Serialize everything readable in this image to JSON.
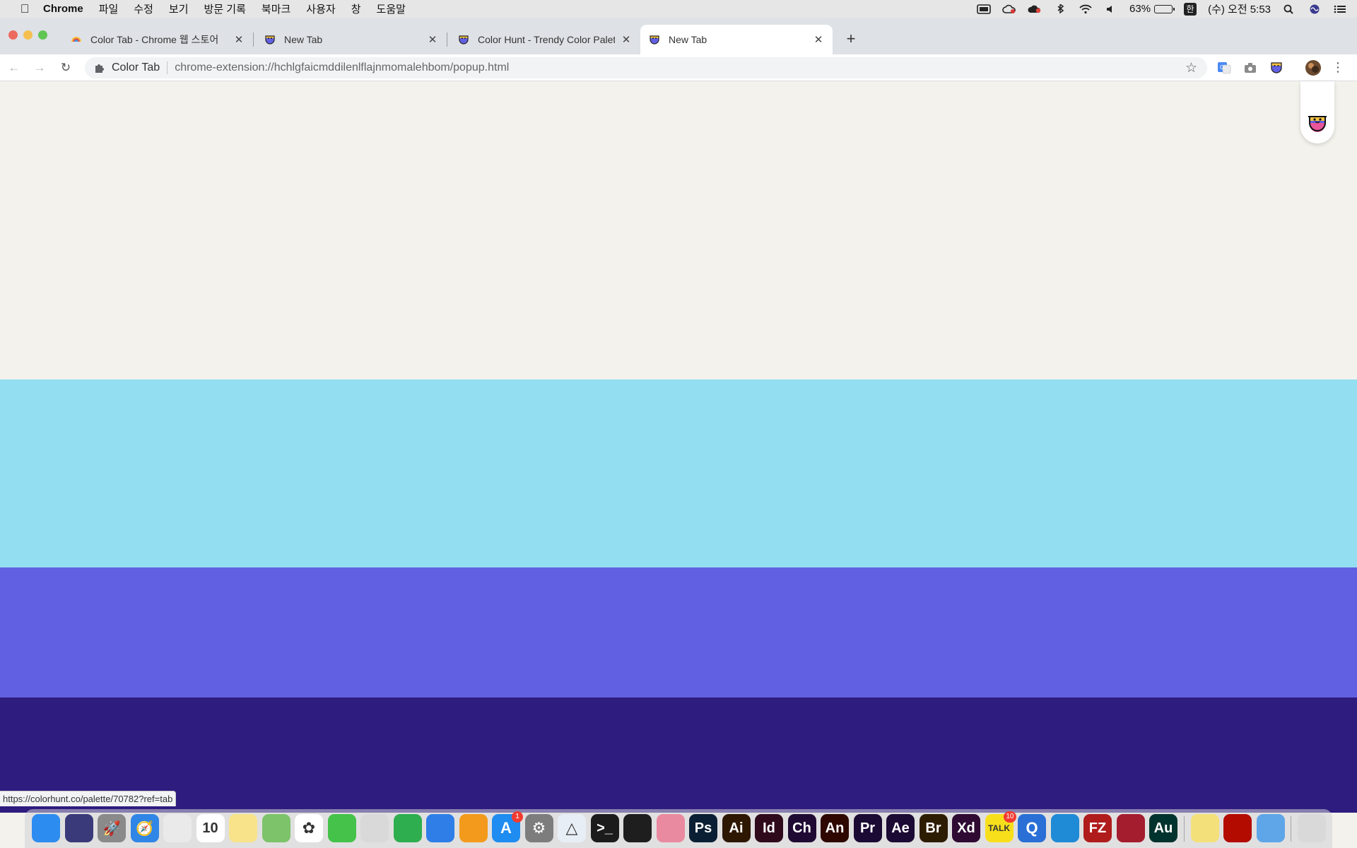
{
  "menubar": {
    "app_name": "Chrome",
    "items": [
      "파일",
      "수정",
      "보기",
      "방문 기록",
      "북마크",
      "사용자",
      "창",
      "도움말"
    ],
    "battery_percent": "63%",
    "battery_level": 0.63,
    "ime_label": "한",
    "clock": "(수) 오전 5:53"
  },
  "tabs": [
    {
      "title": "Color Tab - Chrome 웹 스토어",
      "close": "✕"
    },
    {
      "title": "New Tab",
      "close": "✕"
    },
    {
      "title": "Color Hunt - Trendy Color Palettes",
      "close": "✕"
    },
    {
      "title": "New Tab",
      "close": "✕"
    }
  ],
  "new_tab_glyph": "+",
  "toolbar": {
    "back_glyph": "←",
    "forward_glyph": "→",
    "reload_glyph": "↻",
    "site_chip": "Color Tab",
    "url": "chrome-extension://hchlgfaicmddilenlflajnmomalehbom/popup.html",
    "star_glyph": "☆",
    "menu_glyph": "⋮"
  },
  "palette": {
    "colors": [
      "#f3f2ec",
      "#94def1",
      "#6260e2",
      "#2e1c7e"
    ]
  },
  "status_bar_url": "https://colorhunt.co/palette/70782?ref=tab",
  "dock": {
    "apps": [
      {
        "name": "finder",
        "label": "",
        "color": "#2d8cf0"
      },
      {
        "name": "siri",
        "label": "",
        "color": "#3a3a7a"
      },
      {
        "name": "launchpad",
        "label": "🚀",
        "color": "#8a8a8a"
      },
      {
        "name": "safari",
        "label": "🧭",
        "color": "#2f86e6"
      },
      {
        "name": "chrome",
        "label": "",
        "color": "#eaeaea"
      },
      {
        "name": "calendar",
        "label": "10",
        "color": "#ffffff"
      },
      {
        "name": "notes",
        "label": "",
        "color": "#f8e38a"
      },
      {
        "name": "maps",
        "label": "",
        "color": "#7cc36a"
      },
      {
        "name": "photos",
        "label": "✿",
        "color": "#ffffff"
      },
      {
        "name": "facetime",
        "label": "",
        "color": "#45c24a"
      },
      {
        "name": "preview",
        "label": "",
        "color": "#d9d9d9"
      },
      {
        "name": "numbers",
        "label": "",
        "color": "#2fae4f"
      },
      {
        "name": "keynote",
        "label": "",
        "color": "#2f7ee8"
      },
      {
        "name": "books",
        "label": "",
        "color": "#f39a1c"
      },
      {
        "name": "app-store",
        "label": "A",
        "color": "#1e8cf0",
        "badge": "1"
      },
      {
        "name": "system-preferences",
        "label": "⚙",
        "color": "#7d7d7d"
      },
      {
        "name": "affinity",
        "label": "△",
        "color": "#e8eef5"
      },
      {
        "name": "terminal",
        "label": ">_",
        "color": "#1b1b1b"
      },
      {
        "name": "activity",
        "label": "",
        "color": "#1e1e1e"
      },
      {
        "name": "photo-app",
        "label": "",
        "color": "#e98aa0"
      },
      {
        "name": "photoshop",
        "label": "Ps",
        "color": "#0a1f33"
      },
      {
        "name": "illustrator",
        "label": "Ai",
        "color": "#2d1700"
      },
      {
        "name": "indesign",
        "label": "Id",
        "color": "#2f0a1b"
      },
      {
        "name": "character-animator",
        "label": "Ch",
        "color": "#1f0a33"
      },
      {
        "name": "animate",
        "label": "An",
        "color": "#2d0700"
      },
      {
        "name": "premiere",
        "label": "Pr",
        "color": "#1b0a33"
      },
      {
        "name": "after-effects",
        "label": "Ae",
        "color": "#1b0a33"
      },
      {
        "name": "bridge",
        "label": "Br",
        "color": "#2d1d00"
      },
      {
        "name": "xd",
        "label": "Xd",
        "color": "#2f0a33"
      },
      {
        "name": "kakaotalk",
        "label": "TALK",
        "color": "#f8df1c",
        "badge": "10"
      },
      {
        "name": "quicktime",
        "label": "Q",
        "color": "#2a6fd6"
      },
      {
        "name": "vscode",
        "label": "",
        "color": "#1f8ad6"
      },
      {
        "name": "filezilla",
        "label": "FZ",
        "color": "#b01c1c"
      },
      {
        "name": "mendeley",
        "label": "",
        "color": "#a31d2f"
      },
      {
        "name": "audition",
        "label": "Au",
        "color": "#00332d"
      },
      {
        "name": "stickies",
        "label": "",
        "color": "#f4e07a"
      },
      {
        "name": "acrobat",
        "label": "",
        "color": "#b30b00"
      },
      {
        "name": "finder-folder",
        "label": "",
        "color": "#5fa6e8"
      },
      {
        "name": "trash",
        "label": "",
        "color": "#d9d9d9"
      }
    ]
  }
}
